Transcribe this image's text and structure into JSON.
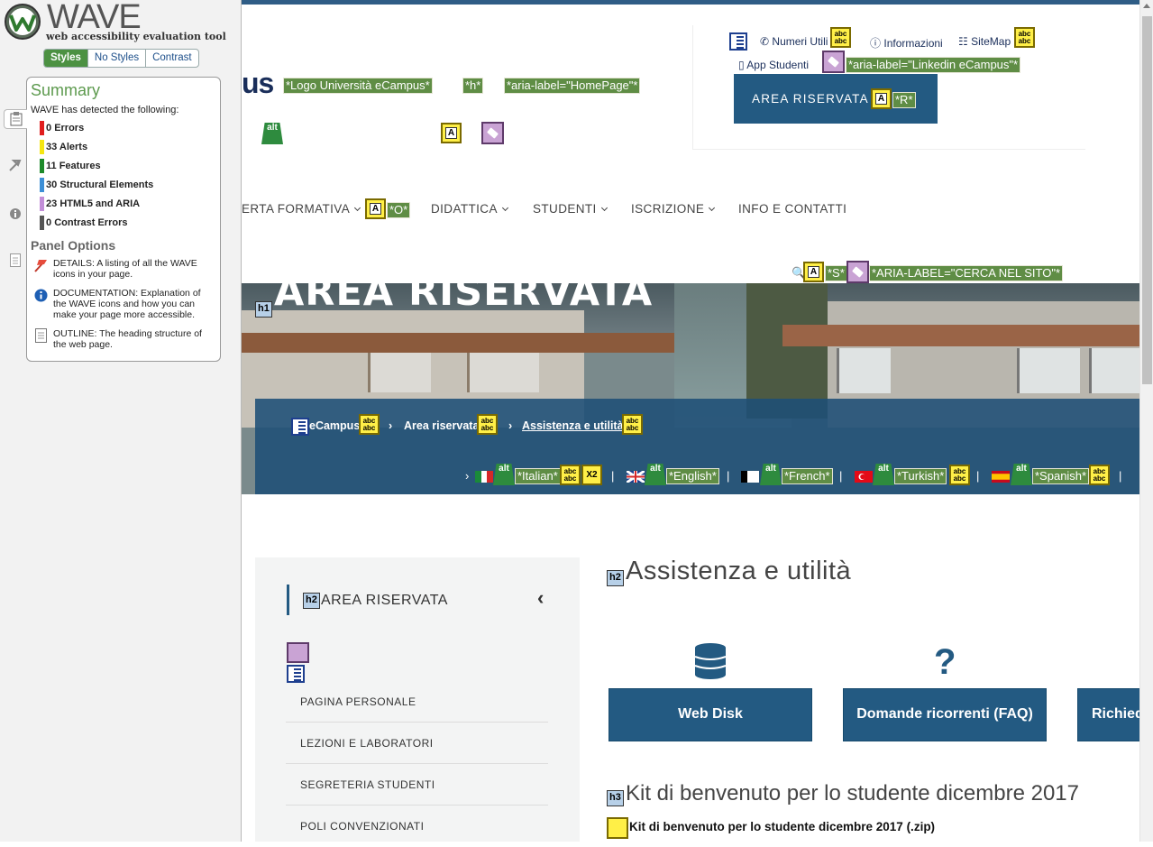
{
  "wave": {
    "title": "WAVE",
    "subtitle": "web accessibility evaluation tool",
    "tabs": [
      "Styles",
      "No Styles",
      "Contrast"
    ],
    "summary_title": "Summary",
    "intro": "WAVE has detected the following:",
    "summary": [
      {
        "count": "0",
        "label": "Errors",
        "color": "#e01e1e"
      },
      {
        "count": "33",
        "label": "Alerts",
        "color": "#f5e611"
      },
      {
        "count": "11",
        "label": "Features",
        "color": "#1d8a2a"
      },
      {
        "count": "30",
        "label": "Structural Elements",
        "color": "#3d8fd6"
      },
      {
        "count": "23",
        "label": "HTML5 and ARIA",
        "color": "#c28ed8"
      },
      {
        "count": "0",
        "label": "Contrast Errors",
        "color": "#555555"
      }
    ],
    "panel_options_title": "Panel Options",
    "options": [
      {
        "text": "DETAILS: A listing of all the WAVE icons in your page.",
        "icon": "flag-icon"
      },
      {
        "text": "DOCUMENTATION: Explanation of the WAVE icons and how you can make your page more accessible.",
        "icon": "info-icon"
      },
      {
        "text": "OUTLINE: The heading structure of the web page.",
        "icon": "outline-icon"
      }
    ]
  },
  "site": {
    "logo_fragment": "us",
    "tags": {
      "logo": "*Logo Università eCampus*",
      "h": "*h*",
      "homepage": "*aria-label=\"HomePage\"*",
      "linkedin": "*aria-label=\"Linkedin eCampus\"*",
      "r": "*R*",
      "o": "*O*",
      "s": "*S*",
      "search": "*ARIA-LABEL=\"CERCA NEL SITO\"*",
      "italian": "*Italian*",
      "english": "*English*",
      "french": "*French*",
      "turkish": "*Turkish*",
      "spanish": "*Spanish*"
    },
    "util_links": [
      "Numeri Utili",
      "Informazioni",
      "SiteMap",
      "App Studenti"
    ],
    "area_button": "AREA RISERVATA",
    "menu": [
      "ERTA FORMATIVA",
      "DIDATTICA",
      "STUDENTI",
      "ISCRIZIONE",
      "INFO E CONTATTI"
    ],
    "hero_title": "AREA RISERVATA",
    "breadcrumb": [
      "eCampus",
      "Area riservata",
      "Assistenza e utilità"
    ],
    "badge_x2": "X2",
    "sidebar": {
      "title": "AREA RISERVATA",
      "items": [
        "PAGINA PERSONALE",
        "LEZIONI E LABORATORI",
        "SEGRETERIA STUDENTI",
        "POLI CONVENZIONATI"
      ]
    },
    "main": {
      "heading": "Assistenza e utilità",
      "services": [
        "Web Disk",
        "Domande ricorrenti (FAQ)",
        "Richied"
      ],
      "kit_heading": "Kit di benvenuto per lo studente dicembre 2017",
      "kit_link": "Kit di benvenuto per lo studente dicembre 2017 (.zip)"
    }
  }
}
